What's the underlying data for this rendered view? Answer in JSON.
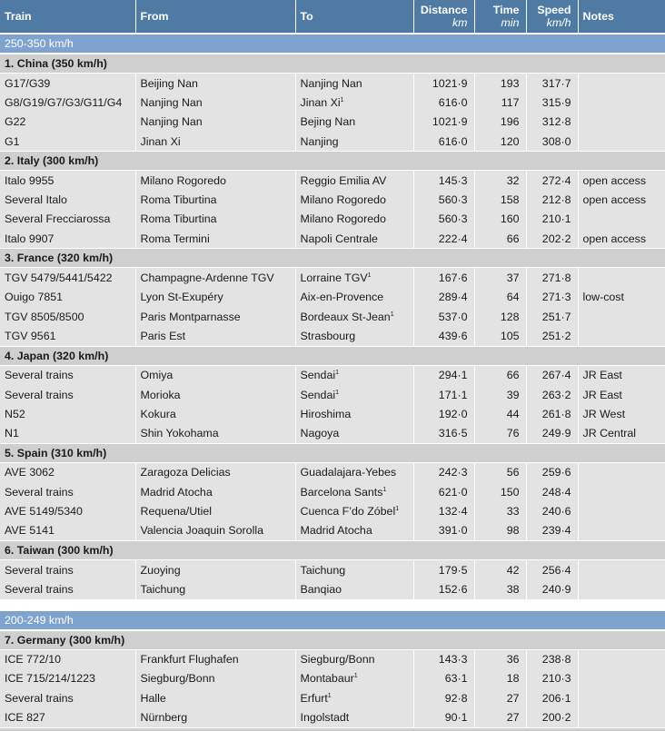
{
  "header": {
    "train": "Train",
    "from": "From",
    "to": "To",
    "distance": "Distance",
    "distance_unit": "km",
    "time": "Time",
    "time_unit": "min",
    "speed": "Speed",
    "speed_unit": "km/h",
    "notes": "Notes"
  },
  "footnote_mark": "1",
  "bands": [
    {
      "label": "250-350 km/h",
      "groups": [
        {
          "title": "1. China (350 km/h)",
          "rows": [
            {
              "train": "G17/G39",
              "from": "Beijing Nan",
              "to": "Nanjing Nan",
              "to_note": false,
              "distance": "1021·9",
              "time": "193",
              "speed": "317·7",
              "notes": ""
            },
            {
              "train": "G8/G19/G7/G3/G11/G4",
              "from": "Nanjing Nan",
              "to": "Jinan Xi",
              "to_note": true,
              "distance": "616·0",
              "time": "117",
              "speed": "315·9",
              "notes": ""
            },
            {
              "train": "G22",
              "from": "Nanjing Nan",
              "to": "Bejing Nan",
              "to_note": false,
              "distance": "1021·9",
              "time": "196",
              "speed": "312·8",
              "notes": ""
            },
            {
              "train": "G1",
              "from": "Jinan Xi",
              "to": "Nanjing",
              "to_note": false,
              "distance": "616·0",
              "time": "120",
              "speed": "308·0",
              "notes": ""
            }
          ]
        },
        {
          "title": "2. Italy (300 km/h)",
          "rows": [
            {
              "train": "Italo 9955",
              "from": "Milano Rogoredo",
              "to": "Reggio Emilia AV",
              "to_note": false,
              "distance": "145·3",
              "time": "32",
              "speed": "272·4",
              "notes": "open access"
            },
            {
              "train": "Several Italo",
              "from": "Roma Tiburtina",
              "to": "Milano Rogoredo",
              "to_note": false,
              "distance": "560·3",
              "time": "158",
              "speed": "212·8",
              "notes": "open access"
            },
            {
              "train": "Several Frecciarossa",
              "from": "Roma Tiburtina",
              "to": "Milano Rogoredo",
              "to_note": false,
              "distance": "560·3",
              "time": "160",
              "speed": "210·1",
              "notes": ""
            },
            {
              "train": "Italo 9907",
              "from": "Roma Termini",
              "to": "Napoli Centrale",
              "to_note": false,
              "distance": "222·4",
              "time": "66",
              "speed": "202·2",
              "notes": "open access"
            }
          ]
        },
        {
          "title": "3. France (320 km/h)",
          "rows": [
            {
              "train": "TGV 5479/5441/5422",
              "from": "Champagne-Ardenne TGV",
              "to": "Lorraine TGV",
              "to_note": true,
              "distance": "167·6",
              "time": "37",
              "speed": "271·8",
              "notes": ""
            },
            {
              "train": "Ouigo 7851",
              "from": "Lyon St-Exupéry",
              "to": "Aix-en-Provence",
              "to_note": false,
              "distance": "289·4",
              "time": "64",
              "speed": "271·3",
              "notes": "low-cost"
            },
            {
              "train": "TGV 8505/8500",
              "from": "Paris Montparnasse",
              "to": "Bordeaux St-Jean",
              "to_note": true,
              "distance": "537·0",
              "time": "128",
              "speed": "251·7",
              "notes": ""
            },
            {
              "train": "TGV 9561",
              "from": "Paris Est",
              "to": "Strasbourg",
              "to_note": false,
              "distance": "439·6",
              "time": "105",
              "speed": "251·2",
              "notes": ""
            }
          ]
        },
        {
          "title": "4. Japan (320 km/h)",
          "rows": [
            {
              "train": "Several trains",
              "from": "Omiya",
              "to": "Sendai",
              "to_note": true,
              "distance": "294·1",
              "time": "66",
              "speed": "267·4",
              "notes": "JR East"
            },
            {
              "train": "Several trains",
              "from": "Morioka",
              "to": "Sendai",
              "to_note": true,
              "distance": "171·1",
              "time": "39",
              "speed": "263·2",
              "notes": "JR East"
            },
            {
              "train": "N52",
              "from": "Kokura",
              "to": "Hiroshima",
              "to_note": false,
              "distance": "192·0",
              "time": "44",
              "speed": "261·8",
              "notes": "JR West"
            },
            {
              "train": "N1",
              "from": "Shin Yokohama",
              "to": "Nagoya",
              "to_note": false,
              "distance": "316·5",
              "time": "76",
              "speed": "249·9",
              "notes": "JR Central"
            }
          ]
        },
        {
          "title": "5. Spain (310 km/h)",
          "rows": [
            {
              "train": "AVE 3062",
              "from": "Zaragoza Delicias",
              "to": "Guadalajara-Yebes",
              "to_note": false,
              "distance": "242·3",
              "time": "56",
              "speed": "259·6",
              "notes": ""
            },
            {
              "train": "Several trains",
              "from": "Madrid Atocha",
              "to": "Barcelona Sants",
              "to_note": true,
              "distance": "621·0",
              "time": "150",
              "speed": "248·4",
              "notes": ""
            },
            {
              "train": "AVE 5149/5340",
              "from": "Requena/Utiel",
              "to": "Cuenca F’do Zóbel",
              "to_note": true,
              "distance": "132·4",
              "time": "33",
              "speed": "240·6",
              "notes": ""
            },
            {
              "train": "AVE 5141",
              "from": "Valencia Joaquin Sorolla",
              "to": "Madrid Atocha",
              "to_note": false,
              "distance": "391·0",
              "time": "98",
              "speed": "239·4",
              "notes": ""
            }
          ]
        },
        {
          "title": "6. Taiwan (300 km/h)",
          "rows": [
            {
              "train": "Several trains",
              "from": "Zuoying",
              "to": "Taichung",
              "to_note": false,
              "distance": "179·5",
              "time": "42",
              "speed": "256·4",
              "notes": ""
            },
            {
              "train": "Several trains",
              "from": "Taichung",
              "to": "Banqiao",
              "to_note": false,
              "distance": "152·6",
              "time": "38",
              "speed": "240·9",
              "notes": ""
            }
          ]
        }
      ]
    },
    {
      "label": "200-249 km/h",
      "groups": [
        {
          "title": "7. Germany (300 km/h)",
          "rows": [
            {
              "train": "ICE 772/10",
              "from": "Frankfurt Flughafen",
              "to": "Siegburg/Bonn",
              "to_note": false,
              "distance": "143·3",
              "time": "36",
              "speed": "238·8",
              "notes": ""
            },
            {
              "train": "ICE 715/214/1223",
              "from": "Siegburg/Bonn",
              "to": "Montabaur",
              "to_note": true,
              "distance": "63·1",
              "time": "18",
              "speed": "210·3",
              "notes": ""
            },
            {
              "train": "Several trains",
              "from": "Halle",
              "to": "Erfurt",
              "to_note": true,
              "distance": "92·8",
              "time": "27",
              "speed": "206·1",
              "notes": ""
            },
            {
              "train": "ICE 827",
              "from": "Nürnberg",
              "to": "Ingolstadt",
              "to_note": false,
              "distance": "90·1",
              "time": "27",
              "speed": "200·2",
              "notes": ""
            }
          ]
        }
      ]
    }
  ]
}
